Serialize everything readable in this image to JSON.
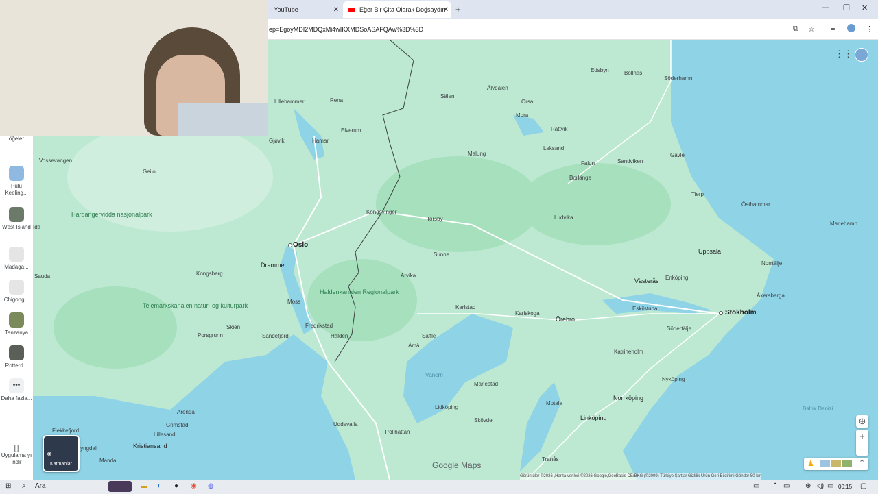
{
  "browser": {
    "tabs": [
      {
        "label": "- YouTube",
        "active": false
      },
      {
        "label": "Eğer Bir Çita Olarak Doğsaydın",
        "active": true
      }
    ],
    "url": "ep=EgoyMDI2MDQxMi4wIKXMDSoASAFQAw%3D%3D"
  },
  "sidebar": {
    "top_label": "öğeler",
    "items": [
      {
        "label": "Pulu Keeling..."
      },
      {
        "label": "West Island"
      },
      {
        "label": "Madaga..."
      },
      {
        "label": "Chigong..."
      },
      {
        "label": "Tanzanya"
      },
      {
        "label": "Rotterd..."
      },
      {
        "label": "Daha fazla..."
      }
    ],
    "app_label": "Uygulama yı indir"
  },
  "map": {
    "labels": [
      {
        "text": "Edsbyn",
        "cls": ""
      },
      {
        "text": "Bollnäs",
        "cls": ""
      },
      {
        "text": "Söderhamn",
        "cls": ""
      },
      {
        "text": "Lillehammer",
        "cls": ""
      },
      {
        "text": "Rena",
        "cls": ""
      },
      {
        "text": "Sälen",
        "cls": ""
      },
      {
        "text": "Älvdalen",
        "cls": ""
      },
      {
        "text": "Orsa",
        "cls": ""
      },
      {
        "text": "Mora",
        "cls": ""
      },
      {
        "text": "Elverum",
        "cls": ""
      },
      {
        "text": "Rättvik",
        "cls": ""
      },
      {
        "text": "Gjøvik",
        "cls": ""
      },
      {
        "text": "Hamar",
        "cls": ""
      },
      {
        "text": "Leksand",
        "cls": ""
      },
      {
        "text": "Vossevangen",
        "cls": ""
      },
      {
        "text": "Geilo",
        "cls": ""
      },
      {
        "text": "Malung",
        "cls": ""
      },
      {
        "text": "Falun",
        "cls": ""
      },
      {
        "text": "Sandviken",
        "cls": ""
      },
      {
        "text": "Gävle",
        "cls": ""
      },
      {
        "text": "Borlänge",
        "cls": ""
      },
      {
        "text": "Tierp",
        "cls": ""
      },
      {
        "text": "Östhammar",
        "cls": ""
      },
      {
        "text": "Mariehamn",
        "cls": ""
      },
      {
        "text": "Kongsvinger",
        "cls": ""
      },
      {
        "text": "Torsby",
        "cls": ""
      },
      {
        "text": "Ludvika",
        "cls": ""
      },
      {
        "text": "Oslo",
        "cls": "cap"
      },
      {
        "text": "Sunne",
        "cls": ""
      },
      {
        "text": "Uppsala",
        "cls": "city"
      },
      {
        "text": "Drammen",
        "cls": "city"
      },
      {
        "text": "Norrtälje",
        "cls": ""
      },
      {
        "text": "Sauda",
        "cls": ""
      },
      {
        "text": "Kongsberg",
        "cls": ""
      },
      {
        "text": "Arvika",
        "cls": ""
      },
      {
        "text": "Västerås",
        "cls": "city"
      },
      {
        "text": "Enköping",
        "cls": ""
      },
      {
        "text": "Åkersberga",
        "cls": ""
      },
      {
        "text": "Moss",
        "cls": ""
      },
      {
        "text": "Karlstad",
        "cls": ""
      },
      {
        "text": "Karlskoga",
        "cls": ""
      },
      {
        "text": "Eskilstuna",
        "cls": ""
      },
      {
        "text": "Stokholm",
        "cls": "cap"
      },
      {
        "text": "Örebro",
        "cls": "city"
      },
      {
        "text": "Skien",
        "cls": ""
      },
      {
        "text": "Fredrikstad",
        "cls": ""
      },
      {
        "text": "Södertälje",
        "cls": ""
      },
      {
        "text": "Porsgrunn",
        "cls": ""
      },
      {
        "text": "Sandefjord",
        "cls": ""
      },
      {
        "text": "Halden",
        "cls": ""
      },
      {
        "text": "Säffle",
        "cls": ""
      },
      {
        "text": "Katrineholm",
        "cls": ""
      },
      {
        "text": "Åmål",
        "cls": ""
      },
      {
        "text": "Vänern",
        "cls": "water"
      },
      {
        "text": "Nyköping",
        "cls": ""
      },
      {
        "text": "Mariestad",
        "cls": ""
      },
      {
        "text": "Norrköping",
        "cls": "city"
      },
      {
        "text": "Lidköping",
        "cls": ""
      },
      {
        "text": "Skövde",
        "cls": ""
      },
      {
        "text": "Motala",
        "cls": ""
      },
      {
        "text": "Linköping",
        "cls": "city"
      },
      {
        "text": "Arendal",
        "cls": ""
      },
      {
        "text": "Grimstad",
        "cls": ""
      },
      {
        "text": "Baltık Denizi",
        "cls": "water"
      },
      {
        "text": "Flekkefjord",
        "cls": ""
      },
      {
        "text": "Lillesand",
        "cls": ""
      },
      {
        "text": "Uddevalla",
        "cls": ""
      },
      {
        "text": "Trollhättan",
        "cls": ""
      },
      {
        "text": "Kristiansand",
        "cls": "city"
      },
      {
        "text": "Mandal",
        "cls": ""
      },
      {
        "text": "Tranås",
        "cls": ""
      },
      {
        "text": "Lyngdal",
        "cls": ""
      },
      {
        "text": "Ida",
        "cls": ""
      }
    ],
    "parks": [
      {
        "text": "Hardangervidda nasjonalpark"
      },
      {
        "text": "Haldenkanalen Regionalpark"
      },
      {
        "text": "Telemarkskanalen natur- og kulturpark"
      }
    ],
    "layers_label": "Katmanlar",
    "logo": "Google Maps",
    "attribution": "Görüntüler ©2026 ,Harita verileri ©2026 Google,GeoBasis-DE/BKG (©2009)   Türkiye   Şartlar   Gizlilik   Ürün Geri Bildirimi Gönder   50 km"
  },
  "taskbar": {
    "search": "Ara",
    "time": "00:15"
  },
  "colors": {
    "land": "#bde9d2",
    "forest": "#a7e0bd",
    "water": "#8fd3e6",
    "road": "#ffffff",
    "border": "#3c4043"
  }
}
